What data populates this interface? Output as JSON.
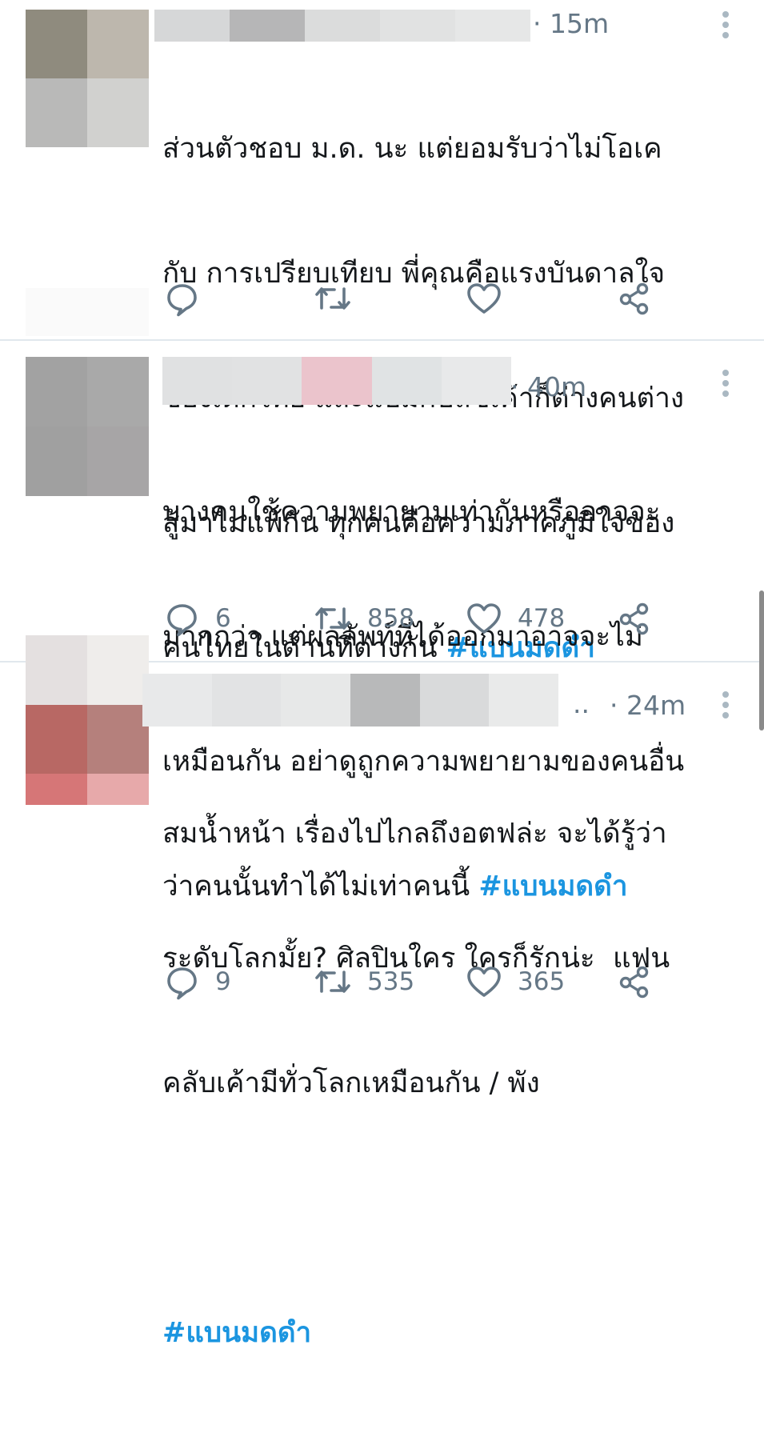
{
  "colors": {
    "text": "#14171a",
    "secondary": "#657786",
    "hashtag": "#1b95e0",
    "divider": "#e1e8ed"
  },
  "tweets": [
    {
      "time": "· 15m",
      "lines": [
        "ส่วนตัวชอบ ม.ด. นะ แต่ยอมรับว่าไม่โอเค",
        "กับ การเปรียบเทียบ พี่คุณคือแรงบันดาลใจ",
        "ของเด็กไทย และแบมกับลิซเค้าก็ต่างคนต่าง",
        "สู้มาไม่แพ้กัน ทุกคนคือความภาคภูมิใจของ",
        "คนไทยในด้านที่ต่างกัน "
      ],
      "hashtag": "#แบนมดดำ",
      "reply_count": "",
      "retweet_count": "",
      "like_count": "",
      "icons": {
        "reply": "reply-icon",
        "retweet": "retweet-icon",
        "like": "heart-icon",
        "share": "share-icon",
        "more": "more-vertical-icon"
      }
    },
    {
      "time": "· 40m",
      "lines": [
        "บางคนใช้ความพยายามเท่ากันหรืออาจจะ",
        "มากกว่า แต่ผลลัพท์ที่ได้ออกมาอาจจะไม่",
        "เหมือนกัน อย่าดูถูกความพยายามของคนอื่น",
        "ว่าคนนั้นทำได้ไม่เท่าคนนี้ "
      ],
      "hashtag": "#แบนมดดำ",
      "reply_count": "6",
      "retweet_count": "858",
      "like_count": "478",
      "icons": {
        "reply": "reply-icon",
        "retweet": "retweet-icon",
        "like": "heart-icon",
        "share": "share-icon",
        "more": "more-vertical-icon"
      }
    },
    {
      "name_suffix": "..",
      "time": "· 24m",
      "lines": [
        "สมน้ำหน้า เรื่องไปไกลถึงอตฟล่ะ จะได้รู้ว่า",
        "ระดับโลกมั้ย? ศิลปินใคร ใครก็รักน่ะ  แฟน",
        "คลับเค้ามีทั่วโลกเหมือนกัน / พัง"
      ],
      "hashtag": "#แบนมดดำ",
      "reply_count": "9",
      "retweet_count": "535",
      "like_count": "365",
      "icons": {
        "reply": "reply-icon",
        "retweet": "retweet-icon",
        "like": "heart-icon",
        "share": "share-icon",
        "more": "more-vertical-icon"
      }
    }
  ]
}
